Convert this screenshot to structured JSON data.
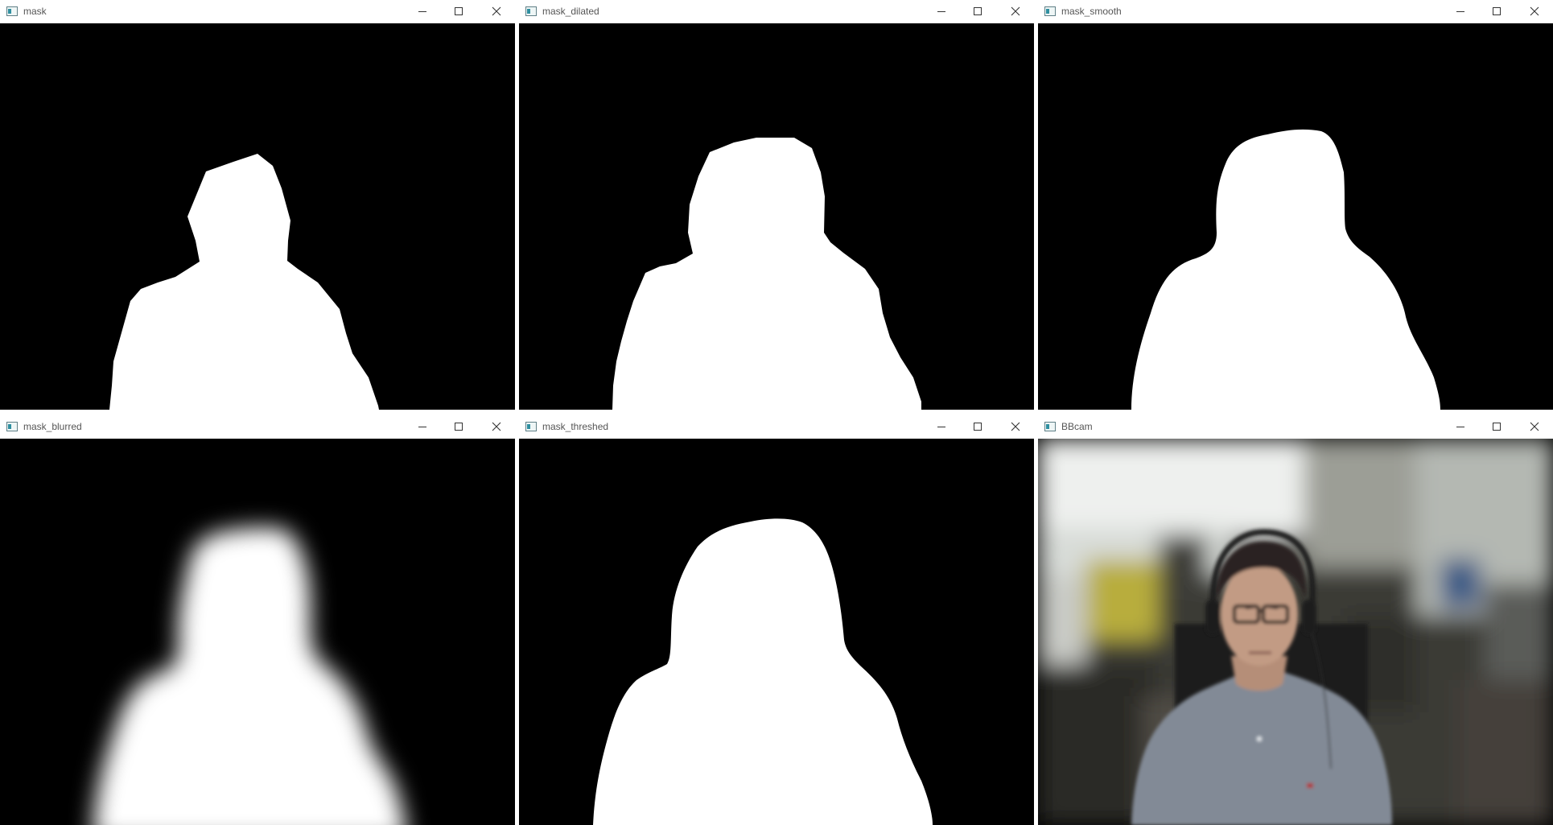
{
  "windows": [
    {
      "id": "mask",
      "title": "mask"
    },
    {
      "id": "mask-dilated",
      "title": "mask_dilated"
    },
    {
      "id": "mask-smooth",
      "title": "mask_smooth"
    },
    {
      "id": "mask-blurred",
      "title": "mask_blurred"
    },
    {
      "id": "mask-threshed",
      "title": "mask_threshed"
    },
    {
      "id": "bbcam",
      "title": "BBcam"
    }
  ],
  "window_controls": {
    "minimize_icon": "minimize-icon",
    "maximize_icon": "maximize-icon",
    "close_icon": "close-icon"
  },
  "colors": {
    "mask_background": "#000000",
    "mask_foreground": "#ffffff",
    "titlebar_background": "#ffffff",
    "title_text": "#555555"
  }
}
